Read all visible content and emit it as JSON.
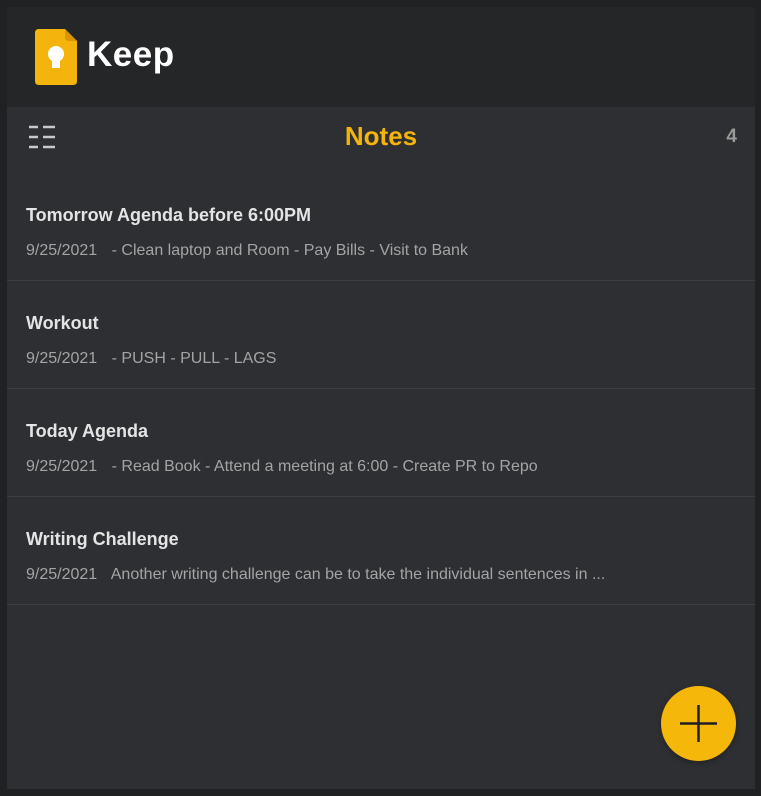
{
  "app": {
    "name": "Keep",
    "logo_icon": "keep-lightbulb-icon",
    "accent_color": "#f5b40b"
  },
  "header": {
    "menu_icon": "menu-icon",
    "title": "Notes",
    "count": "4"
  },
  "notes": [
    {
      "title": "Tomorrow Agenda before 6:00PM",
      "date": "9/25/2021",
      "preview": "- Clean laptop and Room - Pay Bills - Visit to Bank"
    },
    {
      "title": "Workout",
      "date": "9/25/2021",
      "preview": "- PUSH - PULL - LAGS"
    },
    {
      "title": "Today Agenda",
      "date": "9/25/2021",
      "preview": "- Read Book - Attend a meeting at 6:00 - Create PR to Repo"
    },
    {
      "title": "Writing Challenge",
      "date": "9/25/2021",
      "preview": "Another writing challenge can be to take the individual sentences in ..."
    }
  ],
  "fab": {
    "icon": "plus-icon"
  }
}
